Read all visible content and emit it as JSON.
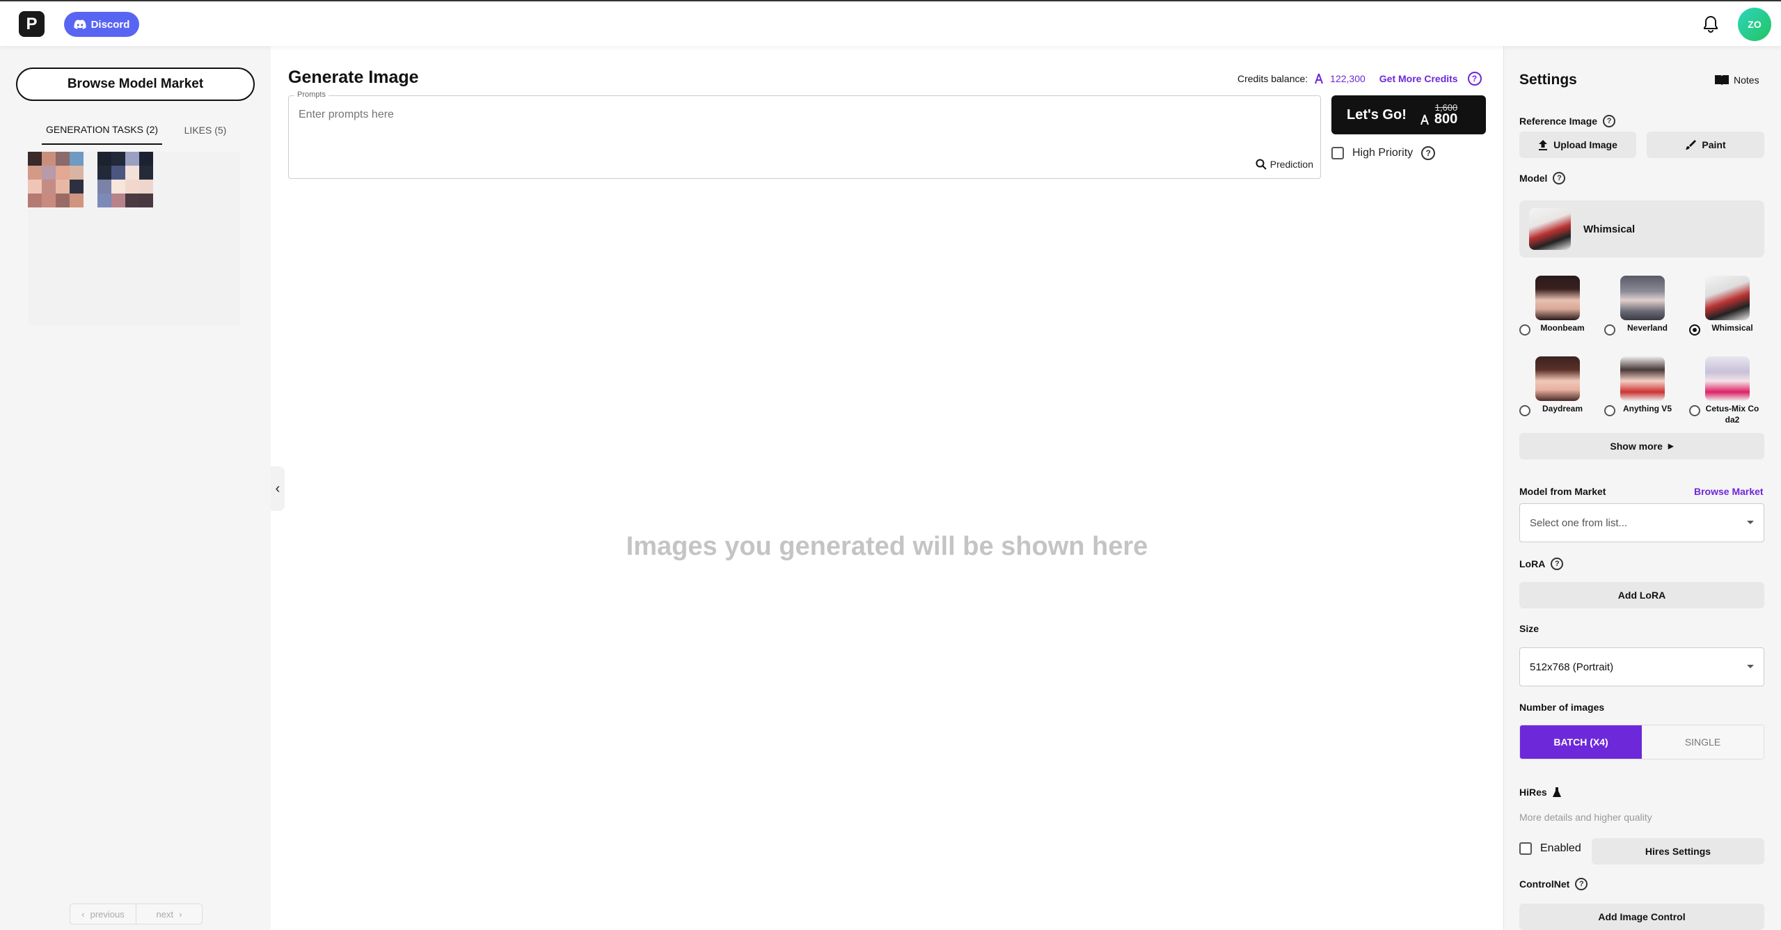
{
  "topbar": {
    "logo_letter": "P",
    "discord_label": "Discord",
    "avatar_initials": "ZO"
  },
  "left": {
    "browse_market_label": "Browse Model Market",
    "tabs": [
      {
        "label": "GENERATION TASKS (2)",
        "active": true
      },
      {
        "label": "LIKES (5)",
        "active": false
      }
    ],
    "pager": {
      "previous": "previous",
      "next": "next"
    }
  },
  "main": {
    "title": "Generate Image",
    "credits_label": "Credits balance:",
    "credits_value": "122,300",
    "get_credits": "Get More Credits",
    "prompt_legend": "Prompts",
    "prompt_placeholder": "Enter prompts here",
    "prediction_label": "Prediction",
    "go_label": "Let's Go!",
    "old_cost": "1,600",
    "new_cost": "800",
    "high_priority": "High Priority",
    "empty_message": "Images you generated will be shown here"
  },
  "settings": {
    "title": "Settings",
    "notes_label": "Notes",
    "reference_image_label": "Reference Image",
    "upload_image": "Upload Image",
    "paint": "Paint",
    "model_label": "Model",
    "selected_model": "Whimsical",
    "models": [
      {
        "name": "Moonbeam",
        "selected": false
      },
      {
        "name": "Neverland",
        "selected": false
      },
      {
        "name": "Whimsical",
        "selected": true
      },
      {
        "name": "Daydream",
        "selected": false
      },
      {
        "name": "Anything V5",
        "selected": false
      },
      {
        "name": "Cetus-Mix Coda2",
        "selected": false
      }
    ],
    "show_more": "Show more",
    "model_from_market": "Model from Market",
    "browse_market": "Browse Market",
    "market_select_placeholder": "Select one from list...",
    "lora_label": "LoRA",
    "add_lora": "Add LoRA",
    "size_label": "Size",
    "size_value": "512x768 (Portrait)",
    "num_images_label": "Number of images",
    "batch_label": "BATCH (X4)",
    "single_label": "SINGLE",
    "hires_label": "HiRes",
    "hires_hint": "More details and higher quality",
    "enabled_label": "Enabled",
    "hires_settings": "Hires Settings",
    "controlnet_label": "ControlNet",
    "add_image_control": "Add Image Control"
  },
  "colors": {
    "accent": "#6d28d9",
    "discord": "#5865f2"
  }
}
